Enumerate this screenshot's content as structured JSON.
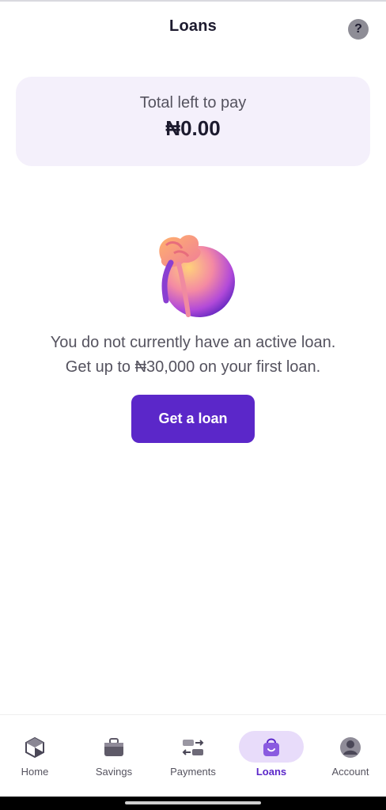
{
  "header": {
    "title": "Loans",
    "help_label": "?"
  },
  "summary": {
    "label": "Total left to pay",
    "amount": "₦0.00"
  },
  "empty_state": {
    "line1": "You do not currently have an active loan.",
    "line2": "Get up to ₦30,000 on your first loan.",
    "cta_label": "Get a loan",
    "illustration": "money-bag"
  },
  "nav": {
    "items": [
      {
        "label": "Home",
        "icon": "home-icon"
      },
      {
        "label": "Savings",
        "icon": "briefcase-icon"
      },
      {
        "label": "Payments",
        "icon": "transfer-icon"
      },
      {
        "label": "Loans",
        "icon": "bag-icon",
        "active": true
      },
      {
        "label": "Account",
        "icon": "user-icon"
      }
    ]
  },
  "colors": {
    "accent": "#5b27c9",
    "card_bg": "#f4f0fb",
    "active_pill": "#e8dcfa"
  }
}
